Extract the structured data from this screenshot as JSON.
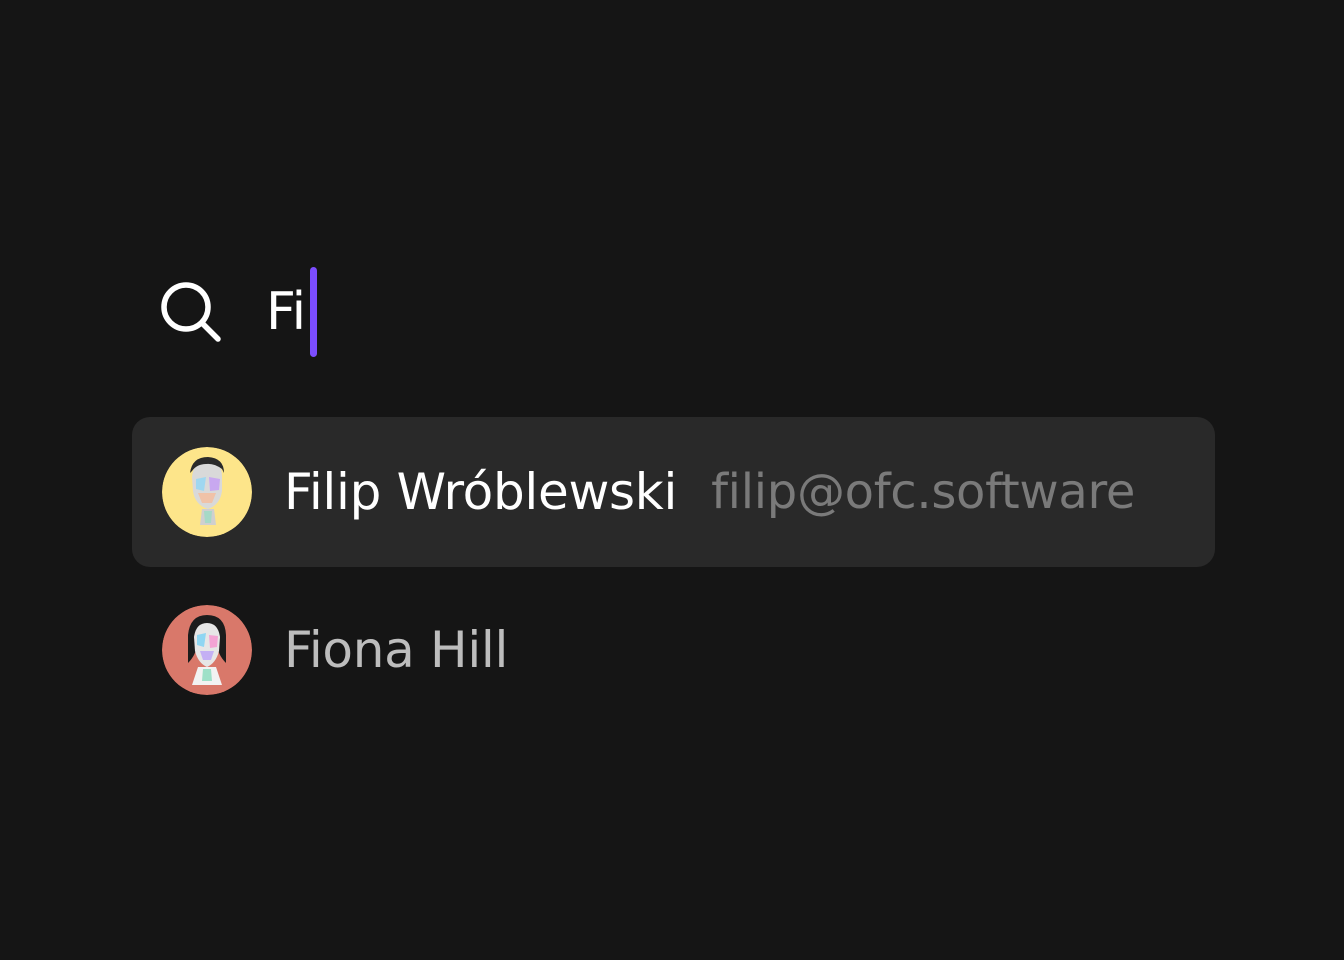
{
  "search": {
    "query": "Fi",
    "icon": "search-icon",
    "caret_color": "#7c4dff"
  },
  "results": [
    {
      "name": "Filip Wróblewski",
      "email": "filip@ofc.software",
      "avatar_color": "#fde58a",
      "highlighted": true
    },
    {
      "name": "Fiona Hill",
      "avatar_color": "#d9786a",
      "highlighted": false
    }
  ],
  "colors": {
    "background": "#151515",
    "row_highlight": "#292929",
    "text_primary": "#ffffff",
    "text_secondary": "#7a7a7a",
    "text_dim": "#bdbdbd"
  }
}
